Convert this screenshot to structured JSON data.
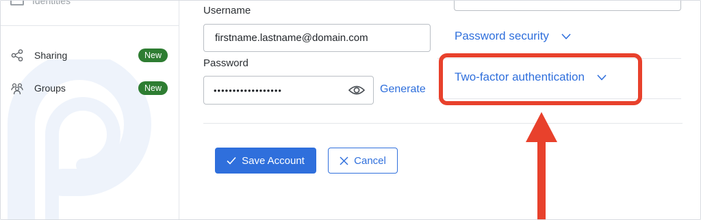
{
  "sidebar": {
    "top_item_label": "Identities",
    "items": [
      {
        "label": "Sharing",
        "badge": "New",
        "icon": "share-icon"
      },
      {
        "label": "Groups",
        "badge": "New",
        "icon": "groups-icon"
      }
    ]
  },
  "form": {
    "username_label": "Username",
    "username_value": "firstname.lastname@domain.com",
    "password_label": "Password",
    "password_masked": "••••••••••••••••••",
    "generate_label": "Generate",
    "save_label": "Save Account",
    "cancel_label": "Cancel"
  },
  "right_panel": {
    "password_security_label": "Password security",
    "two_factor_label": "Two-factor authentication"
  },
  "colors": {
    "accent": "#2f6fdc",
    "badge": "#2e7d32",
    "annotation": "#e8412c"
  }
}
